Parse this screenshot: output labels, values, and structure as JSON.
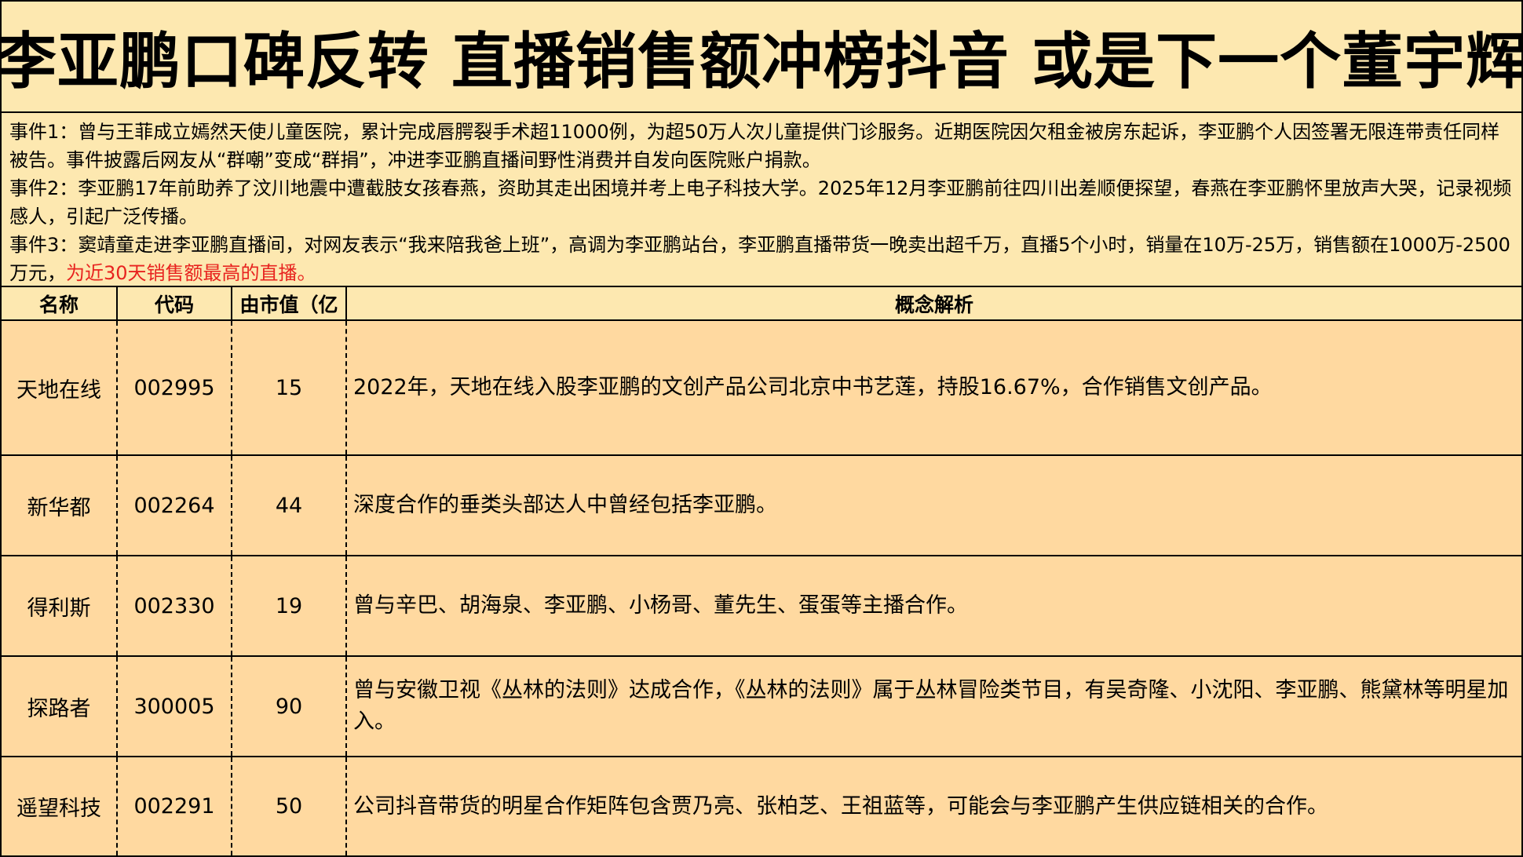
{
  "title": "李亚鹏口碑反转 直播销售额冲榜抖音 或是下一个董宇辉",
  "events": {
    "e1": "事件1：曾与王菲成立嫣然天使儿童医院，累计完成唇腭裂手术超11000例，为超50万人次儿童提供门诊服务。近期医院因欠租金被房东起诉，李亚鹏个人因签署无限连带责任同样被告。事件披露后网友从“群嘲”变成“群捐”，冲进李亚鹏直播间野性消费并自发向医院账户捐款。",
    "e2": "事件2：李亚鹏17年前助养了汶川地震中遭截肢女孩春燕，资助其走出困境并考上电子科技大学。2025年12月李亚鹏前往四川出差顺便探望，春燕在李亚鹏怀里放声大哭，记录视频感人，引起广泛传播。",
    "e3_main": "事件3：窦靖童走进李亚鹏直播间，对网友表示“我来陪我爸上班”，高调为李亚鹏站台，李亚鹏直播带货一晚卖出超千万，直播5个小时，销量在10万-25万，销售额在1000万-2500万元，",
    "e3_red": "为近30天销售额最高的直播。"
  },
  "table": {
    "headers": [
      "名称",
      "代码",
      "由市值（亿",
      "概念解析"
    ],
    "rows": [
      {
        "name": "天地在线",
        "code": "002995",
        "cap": "15",
        "desc": "2022年，天地在线入股李亚鹏的文创产品公司北京中书艺莲，持股16.67%，合作销售文创产品。"
      },
      {
        "name": "新华都",
        "code": "002264",
        "cap": "44",
        "desc": "深度合作的垂类头部达人中曾经包括李亚鹏。"
      },
      {
        "name": "得利斯",
        "code": "002330",
        "cap": "19",
        "desc": "曾与辛巴、胡海泉、李亚鹏、小杨哥、董先生、蛋蛋等主播合作。"
      },
      {
        "name": "探路者",
        "code": "300005",
        "cap": "90",
        "desc": "曾与安徽卫视《丛林的法则》达成合作，《丛林的法则》属于丛林冒险类节目，有吴奇隆、小沈阳、李亚鹏、熊黛林等明星加入。"
      },
      {
        "name": "遥望科技",
        "code": "002291",
        "cap": "50",
        "desc": "公司抖音带货的明星合作矩阵包含贾乃亮、张柏芝、王祖蓝等，可能会与李亚鹏产生供应链相关的合作。"
      }
    ]
  }
}
